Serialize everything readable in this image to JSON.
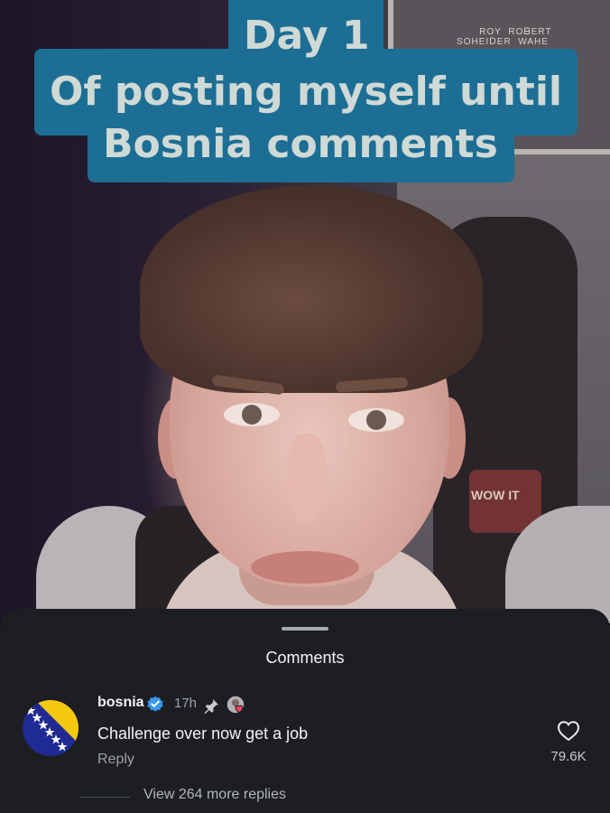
{
  "video": {
    "caption_lines": [
      "Day 1",
      "Of posting myself until",
      "Bosnia comments"
    ],
    "caption_color": "#1d6e94"
  },
  "comments_sheet": {
    "title": "Comments",
    "comment": {
      "username": "bosnia",
      "verified": true,
      "time": "17h",
      "pinned": true,
      "liked_by_creator": true,
      "text": "Challenge over now get a job",
      "reply_label": "Reply",
      "likes": "79.6K",
      "view_replies_label": "View 264 more replies"
    },
    "icons": [
      "verified-badge-icon",
      "pin-icon",
      "creator-like-avatar-icon",
      "heart-icon"
    ],
    "colors": {
      "sheet_bg": "#1c1e22",
      "verified_blue": "#3897f0",
      "text_primary": "#f2f3f5",
      "text_secondary": "#9ea1a6"
    }
  }
}
